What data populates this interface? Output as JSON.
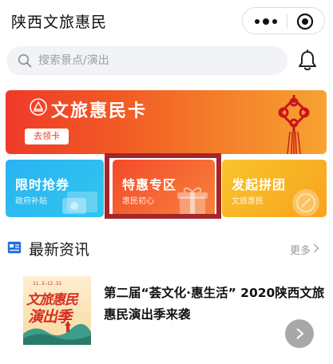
{
  "header": {
    "title": "陕西文旅惠民",
    "capsule": {
      "more_icon": "more-dots-icon",
      "close_icon": "target-circle-icon"
    }
  },
  "search": {
    "placeholder": "搜索景点/演出",
    "icon": "search-icon",
    "bell_icon": "bell-icon"
  },
  "banner": {
    "title": "文旅惠民卡",
    "button_label": "去领卡",
    "logo_icon": "seal-logo-icon",
    "decor_icon": "chinese-knot-icon"
  },
  "cards": [
    {
      "title": "限时抢券",
      "subtitle": "政府补贴",
      "color": "#2ab3f2",
      "icon": "coupon-icon"
    },
    {
      "title": "特惠专区",
      "subtitle": "惠民初心",
      "color": "#f34a2a",
      "icon": "gift-box-icon"
    },
    {
      "title": "发起拼团",
      "subtitle": "文旅惠民",
      "color": "#f7c52c",
      "icon": "coin-icon"
    }
  ],
  "highlight_color": "#a3262a",
  "news": {
    "section_title": "最新资讯",
    "more_label": "更多",
    "items": [
      {
        "title": "第二届“荟文化·惠生活” 2020陕西文旅惠民演出季来袭",
        "thumb_date": "11.3—12.31",
        "thumb_line1": "文旅惠民",
        "thumb_line2": "演出季"
      }
    ]
  }
}
